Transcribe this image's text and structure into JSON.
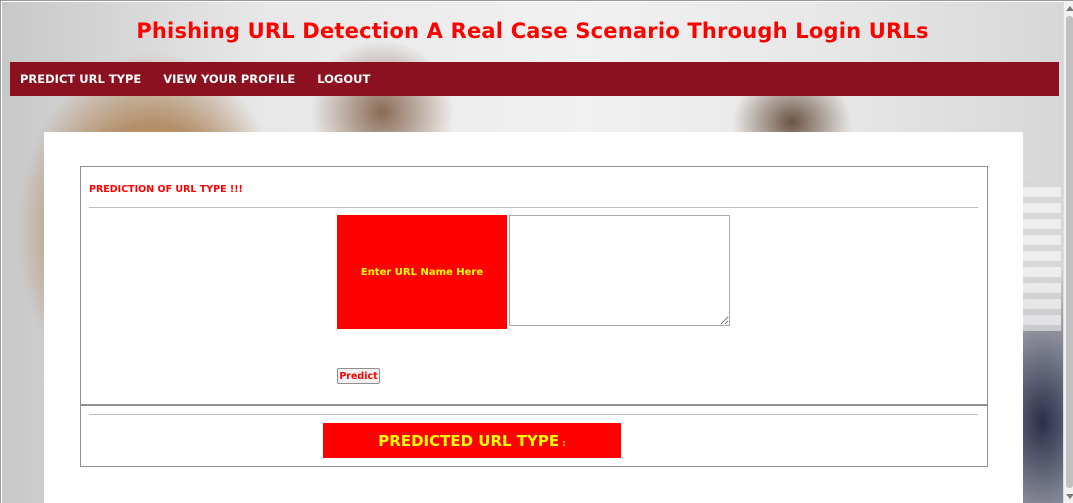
{
  "header": {
    "title": "Phishing URL Detection A Real Case Scenario Through Login URLs"
  },
  "nav": {
    "items": [
      {
        "label": "PREDICT URL TYPE"
      },
      {
        "label": "VIEW YOUR PROFILE"
      },
      {
        "label": "LOGOUT"
      }
    ]
  },
  "form": {
    "section_title": "PREDICTION OF URL TYPE !!!",
    "url_label": "Enter URL Name Here",
    "url_value": "",
    "predict_button": "Predict"
  },
  "result": {
    "label": "PREDICTED URL TYPE",
    "separator": ":",
    "value": ""
  },
  "colors": {
    "title": "#ff0000",
    "navbar": "#8b1020",
    "accent": "#ff0000",
    "label_text": "#ffff00"
  }
}
